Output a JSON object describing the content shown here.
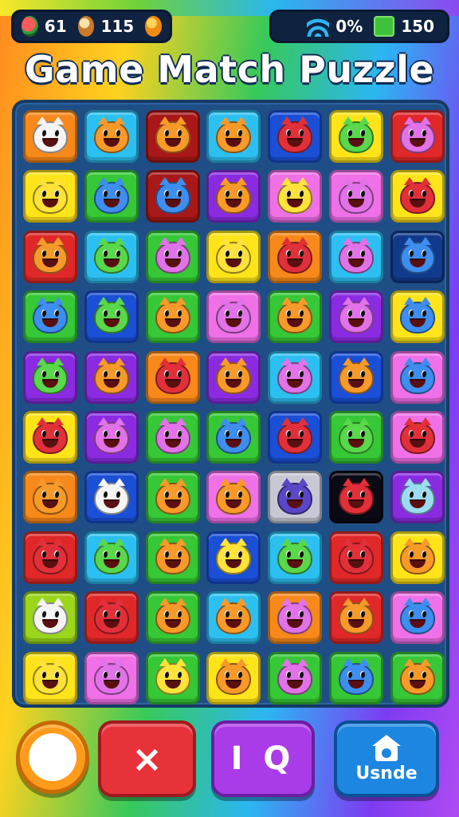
{
  "hud": {
    "left": [
      {
        "icon": "watermelon-icon",
        "value": "61"
      },
      {
        "icon": "bread-icon",
        "value": "115"
      },
      {
        "icon": "orange-icon"
      }
    ],
    "right": [
      {
        "icon": "wifi-icon",
        "value": "0%"
      },
      {
        "icon": "green-square-icon",
        "value": "150"
      }
    ]
  },
  "title": "Game Match Puzzle",
  "board": {
    "rows": 10,
    "cols": 7,
    "colors": {
      "orange": "#f7891a",
      "cyan": "#2cc0f2",
      "red": "#e02828",
      "darkred": "#a81818",
      "blue": "#1a4fd6",
      "green": "#36c836",
      "yellow": "#ffe41a",
      "purple": "#8a2be2",
      "pink": "#f070e8",
      "navy": "#123a8c",
      "gray": "#c8c8d4",
      "black": "#0a0a14",
      "lime": "#9ad61a"
    },
    "tiles": [
      [
        "orange",
        "cyan",
        "darkred",
        "cyan",
        "blue",
        "yellow",
        "red"
      ],
      [
        "yellow",
        "green",
        "darkred",
        "purple",
        "pink",
        "pink",
        "yellow"
      ],
      [
        "red",
        "cyan",
        "green",
        "yellow",
        "orange",
        "cyan",
        "navy"
      ],
      [
        "green",
        "blue",
        "green",
        "pink",
        "green",
        "purple",
        "yellow"
      ],
      [
        "purple",
        "purple",
        "orange",
        "purple",
        "cyan",
        "blue",
        "pink"
      ],
      [
        "yellow",
        "purple",
        "green",
        "green",
        "blue",
        "green",
        "pink"
      ],
      [
        "orange",
        "blue",
        "green",
        "pink",
        "gray",
        "black",
        "purple"
      ],
      [
        "red",
        "cyan",
        "green",
        "blue",
        "cyan",
        "red",
        "yellow"
      ],
      [
        "lime",
        "red",
        "green",
        "cyan",
        "orange",
        "red",
        "pink"
      ],
      [
        "yellow",
        "pink",
        "green",
        "yellow",
        "green",
        "green",
        "green"
      ]
    ],
    "faces": [
      [
        "white",
        "orange",
        "orange",
        "orange",
        "red",
        "green",
        "pink"
      ],
      [
        "yellow",
        "blue",
        "blue",
        "orange",
        "yellow",
        "pink",
        "red"
      ],
      [
        "orange",
        "green",
        "pink",
        "yellow",
        "red",
        "pink",
        "blue"
      ],
      [
        "blue",
        "green",
        "orange",
        "pink",
        "orange",
        "pink",
        "blue"
      ],
      [
        "green",
        "orange",
        "red",
        "orange",
        "pink",
        "orange",
        "blue"
      ],
      [
        "red",
        "pink",
        "pink",
        "blue",
        "red",
        "green",
        "red"
      ],
      [
        "orange",
        "white",
        "orange",
        "orange",
        "purple",
        "red",
        "cyan"
      ],
      [
        "red",
        "green",
        "orange",
        "yellow",
        "green",
        "red",
        "orange"
      ],
      [
        "white",
        "red",
        "orange",
        "orange",
        "pink",
        "orange",
        "blue"
      ],
      [
        "yellow",
        "pink",
        "yellow",
        "orange",
        "pink",
        "blue",
        "orange"
      ]
    ],
    "face_colors": {
      "white": "#f4f4f4",
      "orange": "#f79a2a",
      "red": "#e2303a",
      "green": "#58d84a",
      "pink": "#e272e8",
      "yellow": "#ffe23a",
      "blue": "#3e8ef0",
      "purple": "#5a46c8",
      "cyan": "#9adcf0"
    }
  },
  "buttons": {
    "circle": {
      "icon": "circle-icon"
    },
    "close": {
      "label": "×"
    },
    "iq": {
      "label": "I Q"
    },
    "usnde": {
      "label": "Usnde",
      "icon": "home-icon"
    }
  }
}
